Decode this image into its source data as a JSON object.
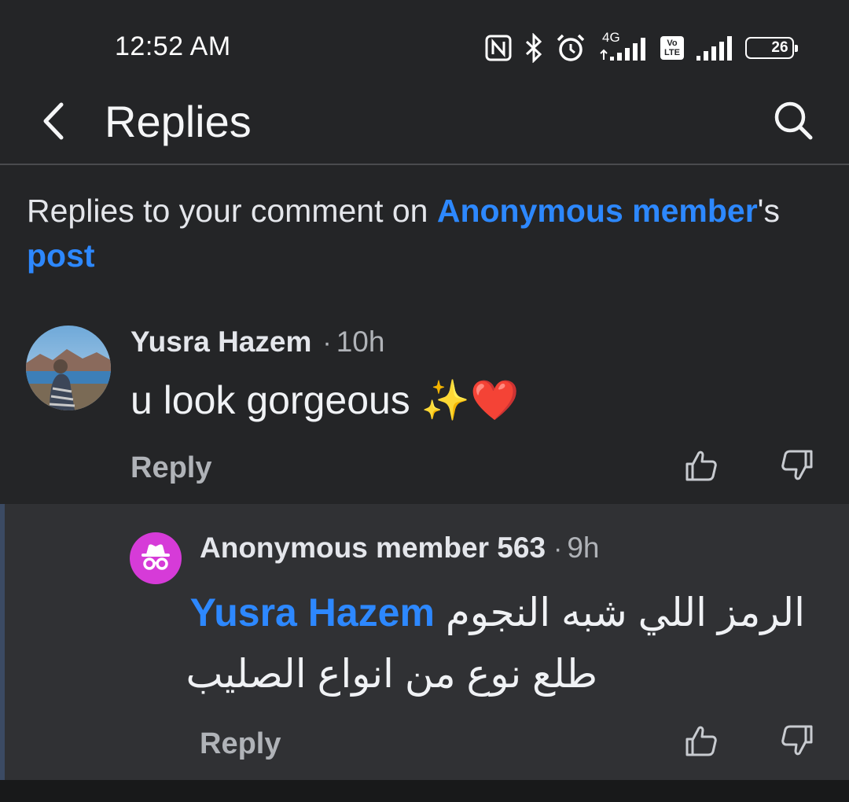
{
  "status_bar": {
    "time": "12:52 AM",
    "network_label": "4G",
    "volte_label": "Vo LTE",
    "battery": "26",
    "icons": [
      "nfc-icon",
      "bluetooth-icon",
      "alarm-icon",
      "signal-4g-icon",
      "volte-icon",
      "signal-icon",
      "battery-icon"
    ]
  },
  "header": {
    "title": "Replies",
    "back_icon": "chevron-left-icon",
    "search_icon": "search-icon"
  },
  "context": {
    "prefix": "Replies to your comment on ",
    "author_link": "Anonymous member",
    "possessive": "'s ",
    "post_link": "post"
  },
  "comments": [
    {
      "author": "Yusra Hazem",
      "separator": "·",
      "time": "10h",
      "text": "u look gorgeous ✨❤️",
      "reply_label": "Reply"
    }
  ],
  "replies": [
    {
      "author": "Anonymous member 563",
      "separator": "·",
      "time": "9h",
      "mention": "Yusra Hazem",
      "text_line1": "الرمز اللي شبه النجوم",
      "text_line2": "طلع نوع من انواع الصليب",
      "reply_label": "Reply"
    }
  ],
  "colors": {
    "background": "#242527",
    "reply_background": "#303134",
    "link": "#2d88ff",
    "anon_avatar": "#d63bd8",
    "muted_text": "#b0b3b8"
  }
}
